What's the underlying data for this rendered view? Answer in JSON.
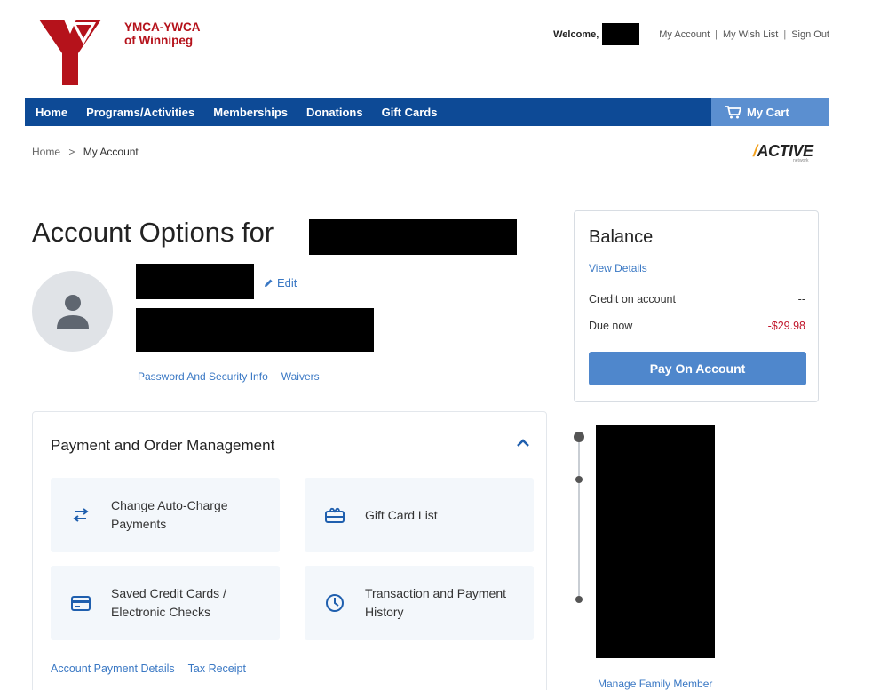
{
  "brand": {
    "line1": "YMCA-YWCA",
    "line2": "of Winnipeg"
  },
  "topbar": {
    "welcome": "Welcome,",
    "links": [
      "My Account",
      "My Wish List",
      "Sign Out"
    ],
    "separator": "|"
  },
  "nav": {
    "items": [
      "Home",
      "Programs/Activities",
      "Memberships",
      "Donations",
      "Gift Cards"
    ],
    "cart": "My Cart"
  },
  "breadcrumb": {
    "home": "Home",
    "separator": ">",
    "current": "My Account"
  },
  "partner": {
    "logo_text": "ACTIVE",
    "logo_sub": "network"
  },
  "account": {
    "title": "Account Options for",
    "edit_label": "Edit",
    "links": [
      "Password And Security Info",
      "Waivers"
    ]
  },
  "balance": {
    "title": "Balance",
    "view_details": "View Details",
    "credit_label": "Credit on account",
    "credit_value": "--",
    "due_label": "Due now",
    "due_value": "-$29.98",
    "pay_button": "Pay On Account"
  },
  "payment": {
    "title": "Payment and Order Management",
    "tiles": [
      {
        "label": "Change Auto-Charge Payments",
        "icon": "swap-arrows-icon"
      },
      {
        "label": "Gift Card List",
        "icon": "gift-card-icon"
      },
      {
        "label": "Saved Credit Cards / Electronic Checks",
        "icon": "credit-card-icon"
      },
      {
        "label": "Transaction and Payment History",
        "icon": "clock-icon"
      }
    ],
    "links": [
      "Account Payment Details",
      "Tax Receipt"
    ]
  },
  "family": {
    "manage_link": "Manage Family Member"
  },
  "colors": {
    "nav_bg": "#0d4a96",
    "cart_bg": "#5b8fd0",
    "link": "#3a78c4",
    "brand_red": "#b5121b",
    "due_red": "#c0152a",
    "button": "#4f87cc"
  }
}
